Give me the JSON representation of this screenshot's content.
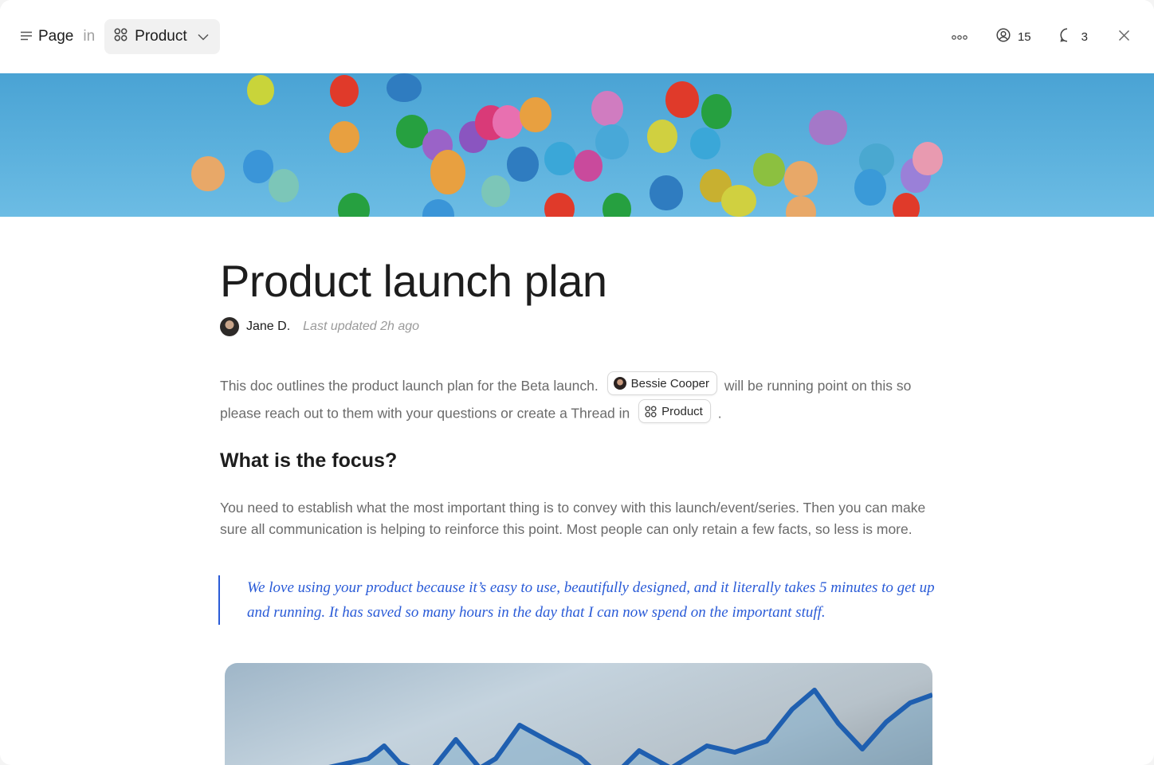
{
  "topbar": {
    "page_label": "Page",
    "in_label": "in",
    "space_name": "Product",
    "watchers_count": "15",
    "comments_count": "3"
  },
  "doc": {
    "title": "Product launch plan",
    "author": "Jane D.",
    "updated": "Last updated 2h ago",
    "para1_before": "This doc outlines the product launch plan for the Beta launch.",
    "mention_person": "Bessie Cooper",
    "para1_middle": "will be running point on this so please reach out to them with your questions or create a Thread in",
    "mention_space": "Product",
    "para1_after": ".",
    "heading": "What is the focus?",
    "para2": "You need to establish what the most important thing is to convey with this launch/event/series. Then you can make sure all communication is helping to reinforce this point. Most people can only retain a few facts, so less is more.",
    "quote": "We love using your product because it’s easy to use, beautifully designed, and it literally takes 5 minutes to get up and running. It has saved so many hours in the day that I can now spend on the important stuff."
  },
  "colors": {
    "accent": "#2a5bd7",
    "sky": "#5cb1dd"
  },
  "icons": [
    "menu-icon",
    "grid-icon",
    "chevron-down-icon",
    "more-icon",
    "user-circle-icon",
    "comment-icon",
    "close-icon"
  ]
}
